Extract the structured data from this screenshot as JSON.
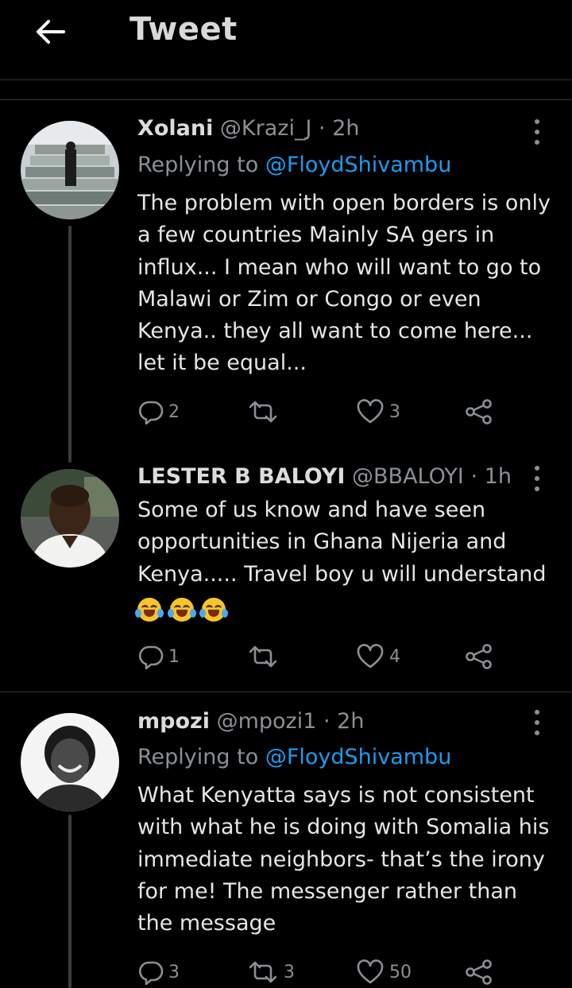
{
  "header": {
    "title": "Tweet",
    "back_icon": "arrow-left-icon"
  },
  "tweets": [
    {
      "name": "Xolani",
      "handle": "@Krazi_J",
      "time": "2h",
      "replying_prefix": "Replying to",
      "replying_to": "@FloydShivambu",
      "text": "The problem with open borders is only a few countries Mainly SA gers in influx... I mean who will want to go to Malawi or Zim or Congo or even Kenya..  they all want to come here... let it be equal...",
      "replies": "2",
      "retweets": "",
      "likes": "3"
    },
    {
      "name": "LESTER B  BALOYI",
      "handle": "@BBALOYI",
      "time": "1h",
      "text": "Some of us know and have seen opportunities in Ghana Nijeria and Kenya..... Travel boy u will understand",
      "emojis": [
        "face-with-tears-of-joy",
        "face-with-tears-of-joy",
        "face-with-tears-of-joy"
      ],
      "replies": "1",
      "retweets": "",
      "likes": "4"
    },
    {
      "name": "mpozi",
      "handle": "@mpozi1",
      "time": "2h",
      "replying_prefix": "Replying to",
      "replying_to": "@FloydShivambu",
      "text": "What Kenyatta says is not consistent with what he is doing with Somalia his immediate neighbors- that’s the irony for me! The messenger rather than the message",
      "replies": "3",
      "retweets": "3",
      "likes": "50"
    }
  ],
  "separator": "·",
  "colors": {
    "background": "#000000",
    "link": "#1d9bf0",
    "muted": "#8b9096",
    "text": "#e7e9ea"
  }
}
